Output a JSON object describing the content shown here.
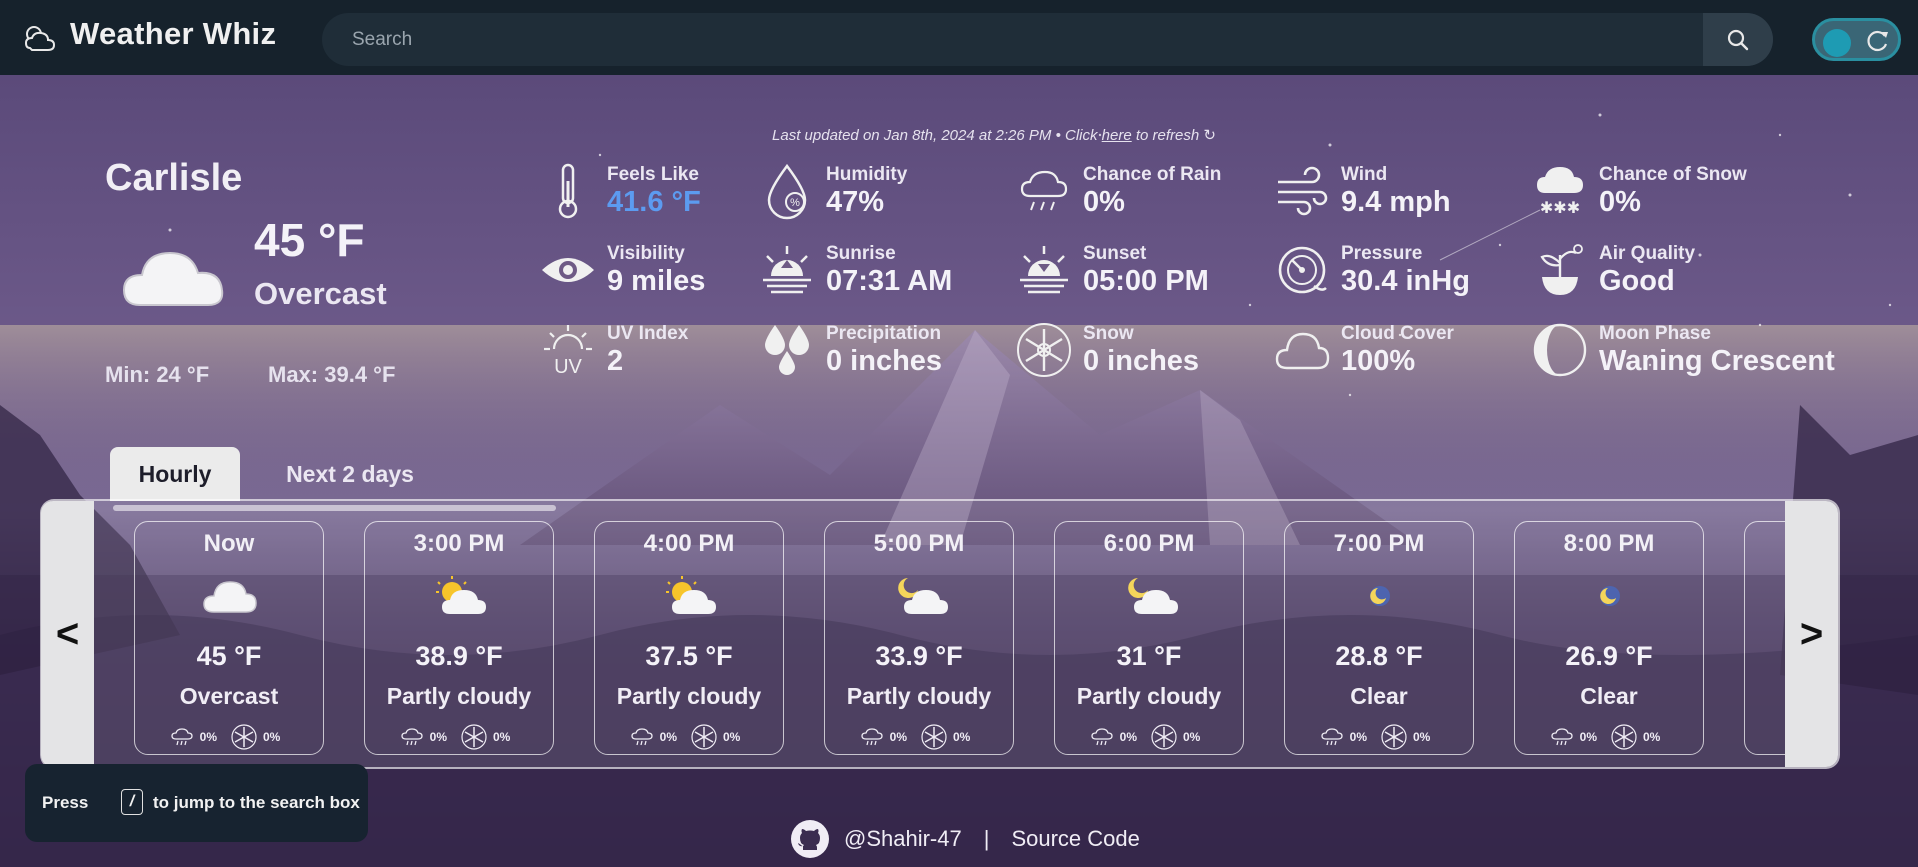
{
  "header": {
    "app_title": "Weather Whiz",
    "search_placeholder": "Search"
  },
  "updated": {
    "prefix": "Last updated on Jan 8th, 2024 at 2:26 PM • Click ",
    "link": "here",
    "suffix": " to refresh ↻"
  },
  "current": {
    "city": "Carlisle",
    "temp": "45 °F",
    "condition": "Overcast",
    "min": "Min: 24 °F",
    "max": "Max: 39.4 °F"
  },
  "stats": [
    {
      "label": "Feels Like",
      "value": "41.6 °F",
      "icon": "thermometer-icon"
    },
    {
      "label": "Humidity",
      "value": "47%",
      "icon": "humidity-icon"
    },
    {
      "label": "Chance of Rain",
      "value": "0%",
      "icon": "rain-cloud-icon"
    },
    {
      "label": "Wind",
      "value": "9.4 mph",
      "icon": "wind-icon"
    },
    {
      "label": "Chance of Snow",
      "value": "0%",
      "icon": "snow-cloud-icon"
    },
    {
      "label": "Visibility",
      "value": "9 miles",
      "icon": "eye-icon"
    },
    {
      "label": "Sunrise",
      "value": "07:31 AM",
      "icon": "sunrise-icon"
    },
    {
      "label": "Sunset",
      "value": "05:00 PM",
      "icon": "sunset-icon"
    },
    {
      "label": "Pressure",
      "value": "30.4 inHg",
      "icon": "pressure-gauge-icon"
    },
    {
      "label": "Air Quality",
      "value": "Good",
      "icon": "air-quality-icon"
    },
    {
      "label": "UV Index",
      "value": "2",
      "icon": "uv-icon"
    },
    {
      "label": "Precipitation",
      "value": "0 inches",
      "icon": "precipitation-icon"
    },
    {
      "label": "Snow",
      "value": "0 inches",
      "icon": "snowflake-icon"
    },
    {
      "label": "Cloud Cover",
      "value": "100%",
      "icon": "cloud-icon"
    },
    {
      "label": "Moon Phase",
      "value": "Waning Crescent",
      "icon": "moon-phase-icon"
    }
  ],
  "tabs": [
    {
      "label": "Hourly",
      "active": true
    },
    {
      "label": "Next 2 days",
      "active": false
    }
  ],
  "nav": {
    "prev": "<",
    "next": ">"
  },
  "hourly": [
    {
      "time": "Now",
      "temp": "45 °F",
      "condition": "Overcast",
      "rain": "0%",
      "snow": "0%",
      "icon": "cloud-icon"
    },
    {
      "time": "3:00 PM",
      "temp": "38.9 °F",
      "condition": "Partly cloudy",
      "rain": "0%",
      "snow": "0%",
      "icon": "sun-cloud-icon"
    },
    {
      "time": "4:00 PM",
      "temp": "37.5 °F",
      "condition": "Partly cloudy",
      "rain": "0%",
      "snow": "0%",
      "icon": "sun-cloud-icon"
    },
    {
      "time": "5:00 PM",
      "temp": "33.9 °F",
      "condition": "Partly cloudy",
      "rain": "0%",
      "snow": "0%",
      "icon": "moon-cloud-icon"
    },
    {
      "time": "6:00 PM",
      "temp": "31 °F",
      "condition": "Partly cloudy",
      "rain": "0%",
      "snow": "0%",
      "icon": "moon-cloud-icon"
    },
    {
      "time": "7:00 PM",
      "temp": "28.8 °F",
      "condition": "Clear",
      "rain": "0%",
      "snow": "0%",
      "icon": "moon-icon"
    },
    {
      "time": "8:00 PM",
      "temp": "26.9 °F",
      "condition": "Clear",
      "rain": "0%",
      "snow": "0%",
      "icon": "moon-icon"
    }
  ],
  "hint": {
    "before": "Press",
    "key": "/",
    "after": "to jump to the search box"
  },
  "footer": {
    "github_user": "@Shahir-47",
    "separator": "|",
    "source": "Source Code"
  },
  "colors": {
    "accent": "#5c9bf0",
    "topbar": "#16222c",
    "toggle": "#1e9bb3"
  }
}
